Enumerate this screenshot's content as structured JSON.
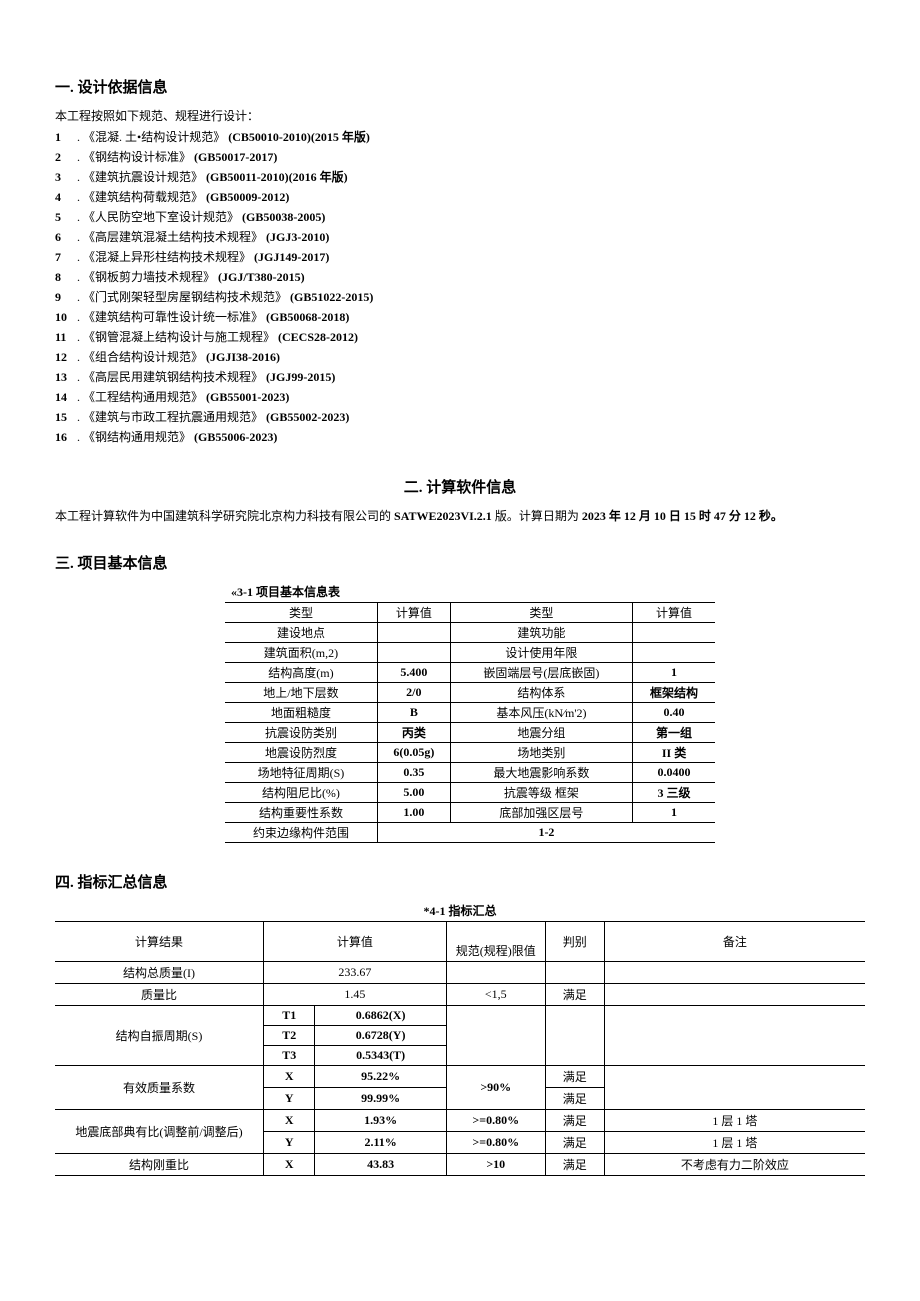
{
  "sec1": {
    "title": "一. 设计依据信息",
    "intro": "本工程按照如下规范、规程进行设计：",
    "items": [
      {
        "num": "1",
        "name": "《混凝. 土•结构设计规范》",
        "code": "(CB50010-2010)(2015 年版)"
      },
      {
        "num": "2",
        "name": "《钢结构设计标准》",
        "code": "(GB50017-2017)"
      },
      {
        "num": "3",
        "name": "《建筑抗震设计规范》",
        "code": "(GB50011-2010)(2016 年版)"
      },
      {
        "num": "4",
        "name": "《建筑结构荷载规范》",
        "code": "(GB50009-2012)"
      },
      {
        "num": "5",
        "name": "《人民防空地下室设计规范》",
        "code": "(GB50038-2005)"
      },
      {
        "num": "6",
        "name": "《高层建筑混凝土结构技术规程》",
        "code": "(JGJ3-2010)"
      },
      {
        "num": "7",
        "name": "《混凝上异形柱结构技术规程》",
        "code": "(JGJ149-2017)"
      },
      {
        "num": "8",
        "name": "《钢板剪力墙技术规程》",
        "code": "(JGJ/T380-2015)"
      },
      {
        "num": "9",
        "name": "《门式刚架轻型房屋钢结构技术规范》",
        "code": "(GB51022-2015)"
      },
      {
        "num": "10",
        "name": "《建筑结构可靠性设计统一标准》",
        "code": "(GB50068-2018)"
      },
      {
        "num": "11",
        "name": "《钢管混凝上结构设计与施工规程》",
        "code": "(CECS28-2012)"
      },
      {
        "num": "12",
        "name": "《组合结构设计规范》",
        "code": "(JGJI38-2016)"
      },
      {
        "num": "13",
        "name": "《高层民用建筑钢结构技术规程》",
        "code": "(JGJ99-2015)"
      },
      {
        "num": "14",
        "name": "《工程结构通用规范》",
        "code": "(GB55001-2023)"
      },
      {
        "num": "15",
        "name": "《建筑与市政工程抗震通用规范》",
        "code": "(GB55002-2023)"
      },
      {
        "num": "16",
        "name": "《钢结构通用规范》",
        "code": "(GB55006-2023)"
      }
    ]
  },
  "sec2": {
    "title": "二. 计算软件信息",
    "text_prefix": "本工程计算软件为中国建筑科学研究院北京构力科技有限公司的 ",
    "software": "SATWE2023VI.2.1",
    "text_mid": " 版。计算日期为 ",
    "date": "2023 年 12 月 10 日 15 时 47 分 12 秒。"
  },
  "sec3": {
    "title": "三. 项目基本信息",
    "table_title": "«3-1 项目基本信息表",
    "rows": [
      [
        "类型",
        "计算值",
        "类型",
        "计算值"
      ],
      [
        "建设地点",
        "",
        "建筑功能",
        ""
      ],
      [
        "建筑面积(m,2)",
        "",
        "设计使用年限",
        ""
      ],
      [
        "结构高度(m)",
        "5.400",
        "嵌固端层号(层底嵌固)",
        "1"
      ],
      [
        "地上/地下层数",
        "2/0",
        "结构体系",
        "框架结构"
      ],
      [
        "地面粗糙度",
        "B",
        "基本风压(kN∕m'2)",
        "0.40"
      ],
      [
        "抗震设防类别",
        "丙类",
        "地震分组",
        "第一组"
      ],
      [
        "地震设防烈度",
        "6(0.05g)",
        "场地类别",
        "II 类"
      ],
      [
        "场地特征周期(S)",
        "0.35",
        "最大地震影响系数",
        "0.0400"
      ],
      [
        "结构阻尼比(%)",
        "5.00",
        "抗震等级       框架",
        "3 三级"
      ],
      [
        "结构重要性系数",
        "1.00",
        "底部加强区层号",
        "1"
      ],
      [
        "约束边缘构件范围",
        "",
        "1-2",
        ""
      ]
    ]
  },
  "sec4": {
    "title": "四. 指标汇总信息",
    "table_title": "*4-1 指标汇总",
    "hdr": {
      "a": "计算结果",
      "b": "计算值",
      "c": "规范(规程)限值",
      "d": "判别",
      "e": "备注"
    },
    "r_mass": {
      "a": "结构总质量(I)",
      "b": "233.67"
    },
    "r_ratio": {
      "a": "质量比",
      "b": "1.45",
      "c": "<1,5",
      "d": "满足"
    },
    "period_label": "结构自振周期(S)",
    "periods": [
      {
        "t": "T1",
        "v": "0.6862(X)"
      },
      {
        "t": "T2",
        "v": "0.6728(Y)"
      },
      {
        "t": "T3",
        "v": "0.5343(T)"
      }
    ],
    "effmass_label": "有效质量系数",
    "effmass": [
      {
        "d": "X",
        "v": "95.22%",
        "lim": ">90%",
        "j": "满足"
      },
      {
        "d": "Y",
        "v": "99.99%",
        "j": "满足"
      }
    ],
    "seis_label": "地震底部典有比(调整前/调整后)",
    "seis": [
      {
        "d": "X",
        "v": "1.93%",
        "lim": ">=0.80%",
        "j": "满足",
        "n": "1 层 1 塔"
      },
      {
        "d": "Y",
        "v": "2.11%",
        "lim": ">=0.80%",
        "j": "满足",
        "n": "1 层 1 塔"
      }
    ],
    "stiff": {
      "a": "结构刚重比",
      "d": "X",
      "v": "43.83",
      "lim": ">10",
      "j": "满足",
      "n": "不考虑有力二阶效应"
    }
  }
}
